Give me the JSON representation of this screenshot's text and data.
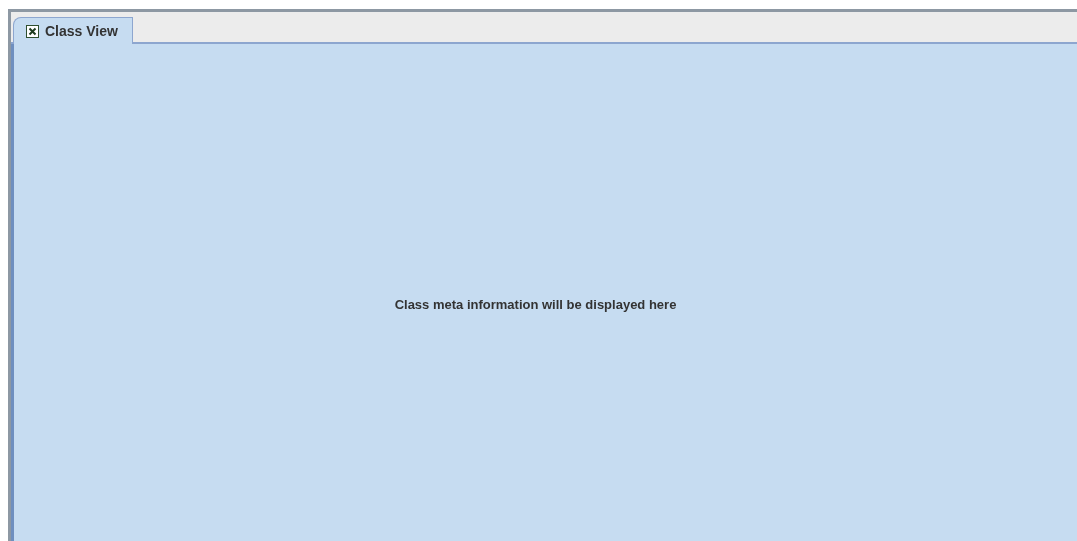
{
  "tabs": [
    {
      "label": "Class View",
      "selected": true
    }
  ],
  "panel": {
    "message": "Class meta information will be displayed here"
  }
}
